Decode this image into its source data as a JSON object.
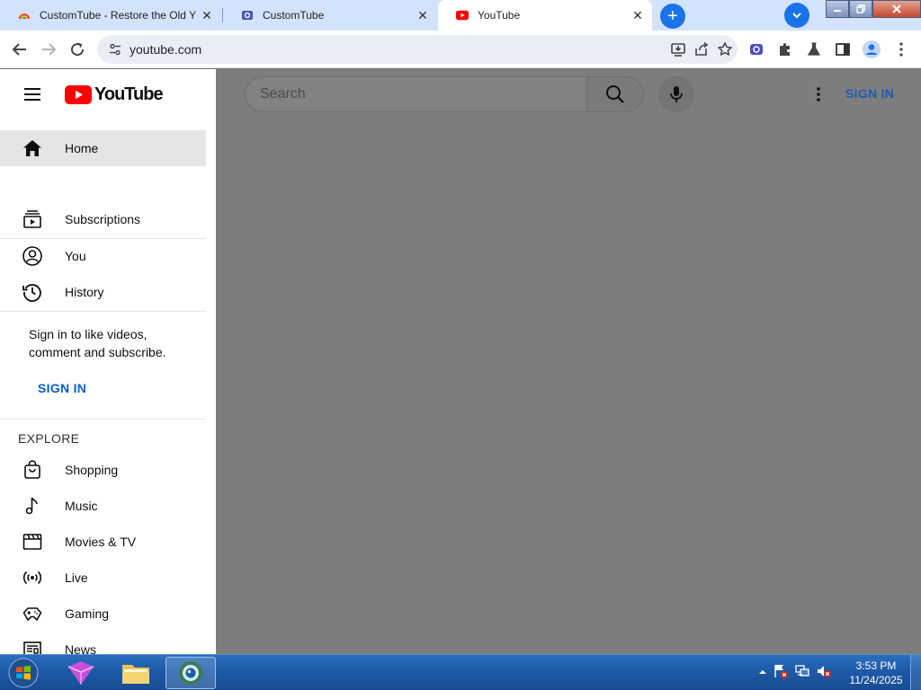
{
  "browser": {
    "tabs": [
      {
        "title": "CustomTube - Restore the Old Y",
        "favicon": "rainbow-icon"
      },
      {
        "title": "CustomTube",
        "favicon": "customtube-icon"
      },
      {
        "title": "YouTube",
        "favicon": "youtube-icon",
        "active": true
      }
    ],
    "url": "youtube.com"
  },
  "youtube": {
    "logo_text": "YouTube",
    "nav_items": [
      {
        "label": "Home",
        "icon": "home-icon"
      },
      {
        "label": "Subscriptions",
        "icon": "subscriptions-icon"
      },
      {
        "label": "You",
        "icon": "account-icon"
      },
      {
        "label": "History",
        "icon": "history-icon"
      }
    ],
    "signin_prompt": "Sign in to like videos, comment and subscribe.",
    "signin_link": "SIGN IN",
    "explore_title": "EXPLORE",
    "explore_items": [
      {
        "label": "Shopping",
        "icon": "shopping-bag-icon"
      },
      {
        "label": "Music",
        "icon": "music-note-icon"
      },
      {
        "label": "Movies & TV",
        "icon": "clapperboard-icon"
      },
      {
        "label": "Live",
        "icon": "live-icon"
      },
      {
        "label": "Gaming",
        "icon": "gamepad-icon"
      },
      {
        "label": "News",
        "icon": "newspaper-icon"
      }
    ],
    "search_placeholder": "Search",
    "signin_top": "SIGN IN"
  },
  "taskbar": {
    "time": "3:53 PM",
    "date": "11/24/2025"
  },
  "colors": {
    "youtube_red": "#ff0000",
    "link_blue": "#065fd4",
    "chrome_blue": "#1a73e8",
    "overlay_gray": "#7d7d7d"
  }
}
